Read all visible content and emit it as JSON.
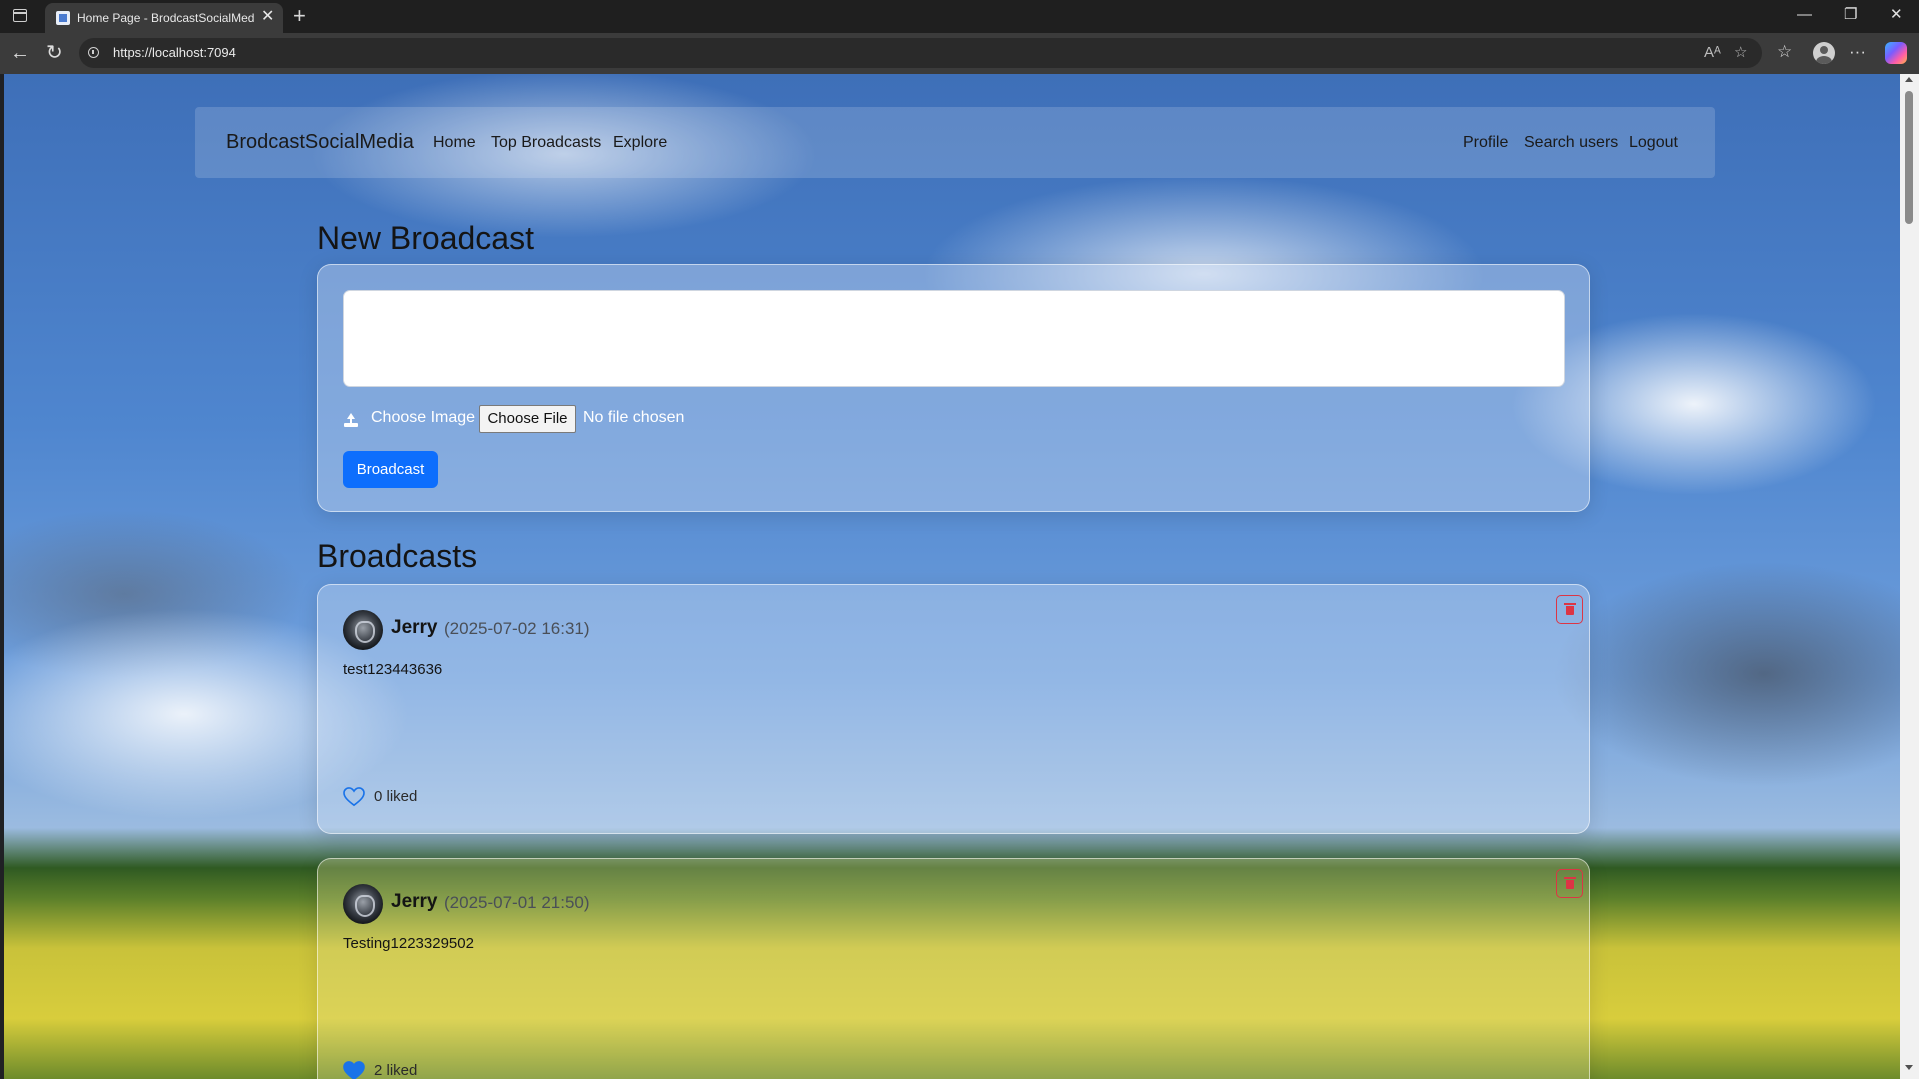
{
  "browser": {
    "tab_title": "Home Page - BrodcastSocialMedia",
    "tab_close": "✕",
    "new_tab": "+",
    "url": "https://localhost:7094",
    "window_minimize": "—",
    "window_restore": "❐",
    "window_close": "✕",
    "back": "←",
    "reload": "↻",
    "read_aloud": "Aᴬ",
    "favorite": "☆",
    "favorites_bar": "☆",
    "more": "···"
  },
  "site": {
    "brand": "BrodcastSocialMedia",
    "nav_left": [
      "Home",
      "Top Broadcasts",
      "Explore"
    ],
    "nav_right": [
      "Profile",
      "Search users",
      "Logout"
    ]
  },
  "composer": {
    "heading": "New Broadcast",
    "textarea_value": "",
    "choose_image_label": "Choose Image",
    "file_button": "Choose File",
    "file_status": "No file chosen",
    "submit": "Broadcast"
  },
  "feed": {
    "heading": "Broadcasts",
    "posts": [
      {
        "author": "Jerry",
        "timestamp": "(2025-07-02 16:31)",
        "text": "test123443636",
        "likes": "0 liked",
        "liked": false
      },
      {
        "author": "Jerry",
        "timestamp": "(2025-07-01 21:50)",
        "text": "Testing1223329502",
        "likes": "2 liked",
        "liked": true
      }
    ]
  },
  "colors": {
    "primary": "#0d6efd",
    "danger": "#dc3545",
    "like": "#1a73e8"
  }
}
